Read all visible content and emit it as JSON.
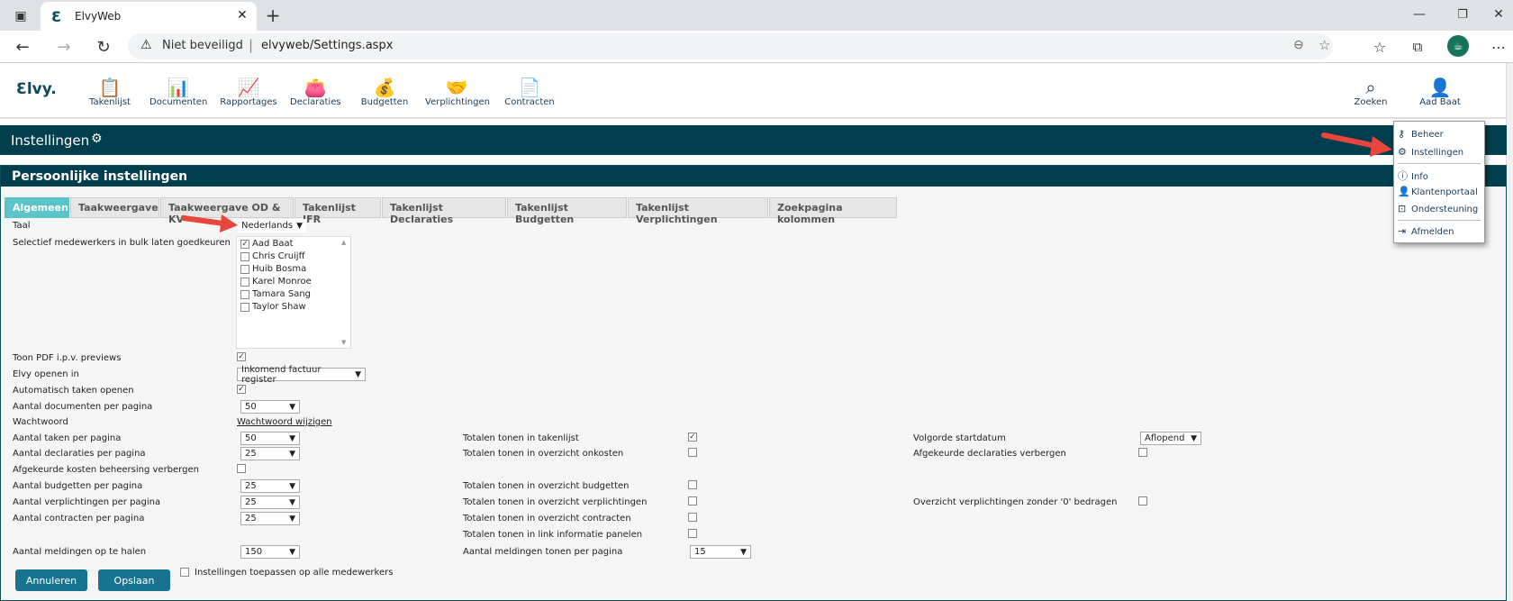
{
  "browser": {
    "tab_title": "ElvyWeb",
    "security_label": "Niet beveiligd",
    "url": "elvyweb/Settings.aspx"
  },
  "app": {
    "logo": "Ɛlvy.",
    "nav": [
      {
        "label": "Takenlijst",
        "icon": "clipboard-icon"
      },
      {
        "label": "Documenten",
        "icon": "document-chart-icon"
      },
      {
        "label": "Rapportages",
        "icon": "chart-icon"
      },
      {
        "label": "Declaraties",
        "icon": "wallet-icon"
      },
      {
        "label": "Budgetten",
        "icon": "money-bag-icon"
      },
      {
        "label": "Verplichtingen",
        "icon": "handshake-icon"
      },
      {
        "label": "Contracten",
        "icon": "contract-icon"
      }
    ],
    "search_label": "Zoeken",
    "user_label": "Aad Baat"
  },
  "page_title": "Instellingen",
  "panel_title": "Persoonlijke instellingen",
  "tabs": [
    "Algemeen",
    "Taakweergave",
    "Taakweergave OD & KV",
    "Takenlijst IFR",
    "Takenlijst Declaraties",
    "Takenlijst Budgetten",
    "Takenlijst Verplichtingen",
    "Zoekpagina kolommen"
  ],
  "settings": {
    "taal_label": "Taal",
    "taal_value": "Nederlands",
    "bulk_label": "Selectief medewerkers in bulk laten goedkeuren",
    "users": [
      {
        "name": "Aad Baat",
        "checked": true
      },
      {
        "name": "Chris Cruijff",
        "checked": false
      },
      {
        "name": "Huib Bosma",
        "checked": false
      },
      {
        "name": "Karel Monroe",
        "checked": false
      },
      {
        "name": "Tamara Sang",
        "checked": false
      },
      {
        "name": "Taylor Shaw",
        "checked": false
      }
    ],
    "pdf_label": "Toon PDF i.p.v. previews",
    "open_in_label": "Elvy openen in",
    "open_in_value": "Inkomend factuur register",
    "auto_open_label": "Automatisch taken openen",
    "docs_per_page_label": "Aantal documenten per pagina",
    "docs_per_page_value": "50",
    "password_label": "Wachtwoord",
    "password_link": "Wachtwoord wijzigen",
    "tasks_per_page_label": "Aantal taken per pagina",
    "tasks_per_page_value": "50",
    "decl_per_page_label": "Aantal declaraties per pagina",
    "decl_per_page_value": "25",
    "hide_rejected_costs_label": "Afgekeurde kosten beheersing verbergen",
    "budgets_per_page_label": "Aantal budgetten per pagina",
    "budgets_per_page_value": "25",
    "commitments_per_page_label": "Aantal verplichtingen per pagina",
    "commitments_per_page_value": "25",
    "contracts_per_page_label": "Aantal contracten per pagina",
    "contracts_per_page_value": "25",
    "notifications_fetch_label": "Aantal meldingen op te halen",
    "notifications_fetch_value": "150",
    "totals_tasklist_label": "Totalen tonen in takenlijst",
    "totals_costs_label": "Totalen tonen in overzicht onkosten",
    "totals_budgets_label": "Totalen tonen in overzicht budgetten",
    "totals_commitments_label": "Totalen tonen in overzicht verplichtingen",
    "totals_contracts_label": "Totalen tonen in overzicht contracten",
    "totals_link_label": "Totalen tonen in link informatie panelen",
    "notifications_per_page_label": "Aantal meldingen tonen per pagina",
    "notifications_per_page_value": "15",
    "start_order_label": "Volgorde startdatum",
    "start_order_value": "Aflopend",
    "hide_rejected_decl_label": "Afgekeurde declaraties verbergen",
    "zero_commitments_label": "Overzicht verplichtingen zonder '0' bedragen",
    "apply_all_label": "Instellingen toepassen op alle medewerkers"
  },
  "buttons": {
    "cancel": "Annuleren",
    "save": "Opslaan"
  },
  "user_menu": [
    "Beheer",
    "Instellingen",
    "Info",
    "Klantenportaal",
    "Ondersteuning",
    "Afmelden"
  ],
  "colors": {
    "header_bg": "#013e4e",
    "active_tab": "#5bc4c8",
    "button": "#17738f",
    "annotation_arrow": "#e8453c"
  }
}
